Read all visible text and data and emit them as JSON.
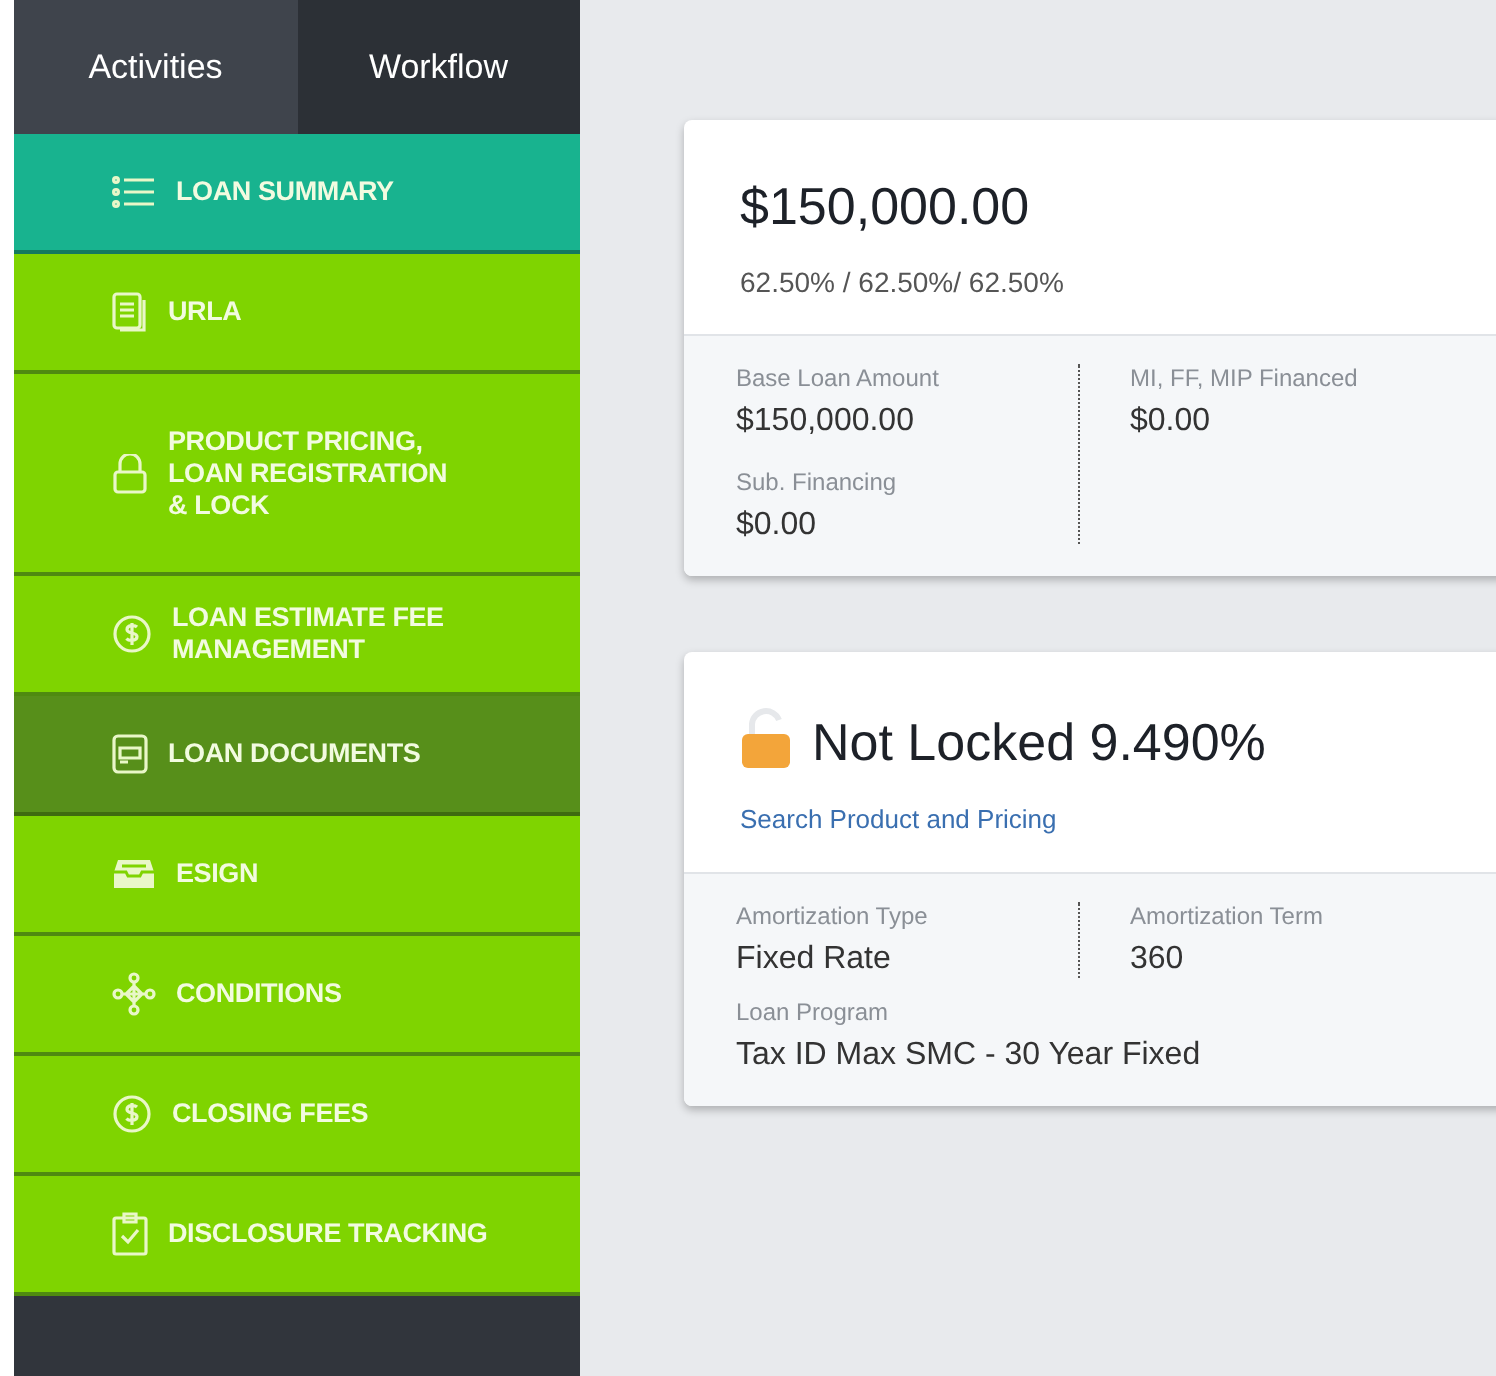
{
  "sidebar": {
    "tabs": [
      {
        "label": "Activities",
        "selected": true
      },
      {
        "label": "Workflow",
        "selected": false
      }
    ],
    "items": [
      {
        "label": "LOAN SUMMARY",
        "selected": true,
        "shaded": false
      },
      {
        "label": "URLA",
        "selected": false,
        "shaded": false
      },
      {
        "label": "PRODUCT PRICING, LOAN REGISTRATION & LOCK",
        "selected": false,
        "shaded": false
      },
      {
        "label": "LOAN ESTIMATE FEE MANAGEMENT",
        "selected": false,
        "shaded": false
      },
      {
        "label": "LOAN DOCUMENTS",
        "selected": false,
        "shaded": true
      },
      {
        "label": "ESIGN",
        "selected": false,
        "shaded": false
      },
      {
        "label": "CONDITIONS",
        "selected": false,
        "shaded": false
      },
      {
        "label": "CLOSING FEES",
        "selected": false,
        "shaded": false
      },
      {
        "label": "DISCLOSURE TRACKING",
        "selected": false,
        "shaded": false
      }
    ]
  },
  "cards": [
    {
      "title": "$150,000.00",
      "subtitle": "62.50% / 62.50%/ 62.50%",
      "columns": [
        [
          {
            "label": "Base Loan Amount",
            "value": "$150,000.00"
          },
          {
            "label": "Sub. Financing",
            "value": "$0.00"
          }
        ],
        [
          {
            "label": "MI, FF, MIP Financed",
            "value": "$0.00"
          }
        ]
      ]
    },
    {
      "title": "Not Locked 9.490%",
      "locked": false,
      "link": "Search Product and Pricing",
      "columns": [
        [
          {
            "label": "Amortization Type",
            "value": "Fixed Rate"
          }
        ],
        [
          {
            "label": "Amortization Term",
            "value": "360"
          }
        ]
      ],
      "below": [
        {
          "label": "Loan Program",
          "value": "Tax ID Max SMC - 30 Year Fixed"
        }
      ]
    }
  ]
}
